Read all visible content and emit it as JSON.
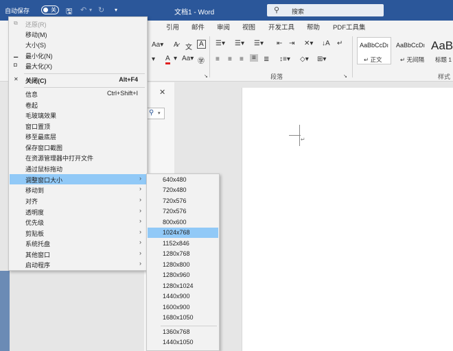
{
  "titlebar": {
    "autosave_label": "自动保存",
    "autosave_state": "关",
    "title": "文档1  -  Word",
    "search_placeholder": "搜索"
  },
  "ribbon_tabs": [
    "引用",
    "邮件",
    "审阅",
    "视图",
    "开发工具",
    "帮助",
    "PDF工具集"
  ],
  "ribbon": {
    "paragraph_group_label": "段落",
    "styles_group_label": "样式",
    "styles": [
      {
        "preview": "AaBbCcDı",
        "name": "↵ 正文"
      },
      {
        "preview": "AaBbCcDı",
        "name": "↵ 无间隔"
      },
      {
        "preview": "AaB",
        "name": "标题 1"
      }
    ]
  },
  "context_menu": {
    "items": [
      {
        "label": "还原(R)",
        "icon": "restore-icon",
        "disabled": true
      },
      {
        "label": "移动(M)"
      },
      {
        "label": "大小(S)"
      },
      {
        "label": "最小化(N)",
        "icon": "minimize-icon"
      },
      {
        "label": "最大化(X)",
        "icon": "maximize-icon"
      },
      {
        "label": "关闭(C)",
        "shortcut": "Alt+F4",
        "icon": "close-icon",
        "bold": true
      },
      {
        "label": "信息",
        "shortcut": "Ctrl+Shift+I"
      },
      {
        "label": "卷起"
      },
      {
        "label": "毛玻璃效果"
      },
      {
        "label": "窗口置顶"
      },
      {
        "label": "移至最底层"
      },
      {
        "label": "保存窗口截图"
      },
      {
        "label": "在资源管理器中打开文件"
      },
      {
        "label": "通过鼠标拖动"
      },
      {
        "label": "调整窗口大小",
        "submenu": true,
        "highlighted": true
      },
      {
        "label": "移动到",
        "submenu": true
      },
      {
        "label": "对齐",
        "submenu": true
      },
      {
        "label": "透明度",
        "submenu": true
      },
      {
        "label": "优先级",
        "submenu": true
      },
      {
        "label": "剪贴板",
        "submenu": true
      },
      {
        "label": "系统托盘",
        "submenu": true
      },
      {
        "label": "其他窗口",
        "submenu": true
      },
      {
        "label": "启动程序",
        "submenu": true
      }
    ]
  },
  "resize_submenu": {
    "items": [
      "640x480",
      "720x480",
      "720x576",
      "720x576",
      "800x600",
      "1024x768",
      "1152x846",
      "1280x768",
      "1280x800",
      "1280x960",
      "1280x1024",
      "1440x900",
      "1600x900",
      "1680x1050",
      "1360x768",
      "1440x1050"
    ],
    "highlighted_index": 5
  },
  "colors": {
    "titlebar": "#2b579a",
    "menu_highlight": "#91c9f7",
    "menu_background": "#f2f2f2",
    "font_color_accent": "#e02020"
  }
}
